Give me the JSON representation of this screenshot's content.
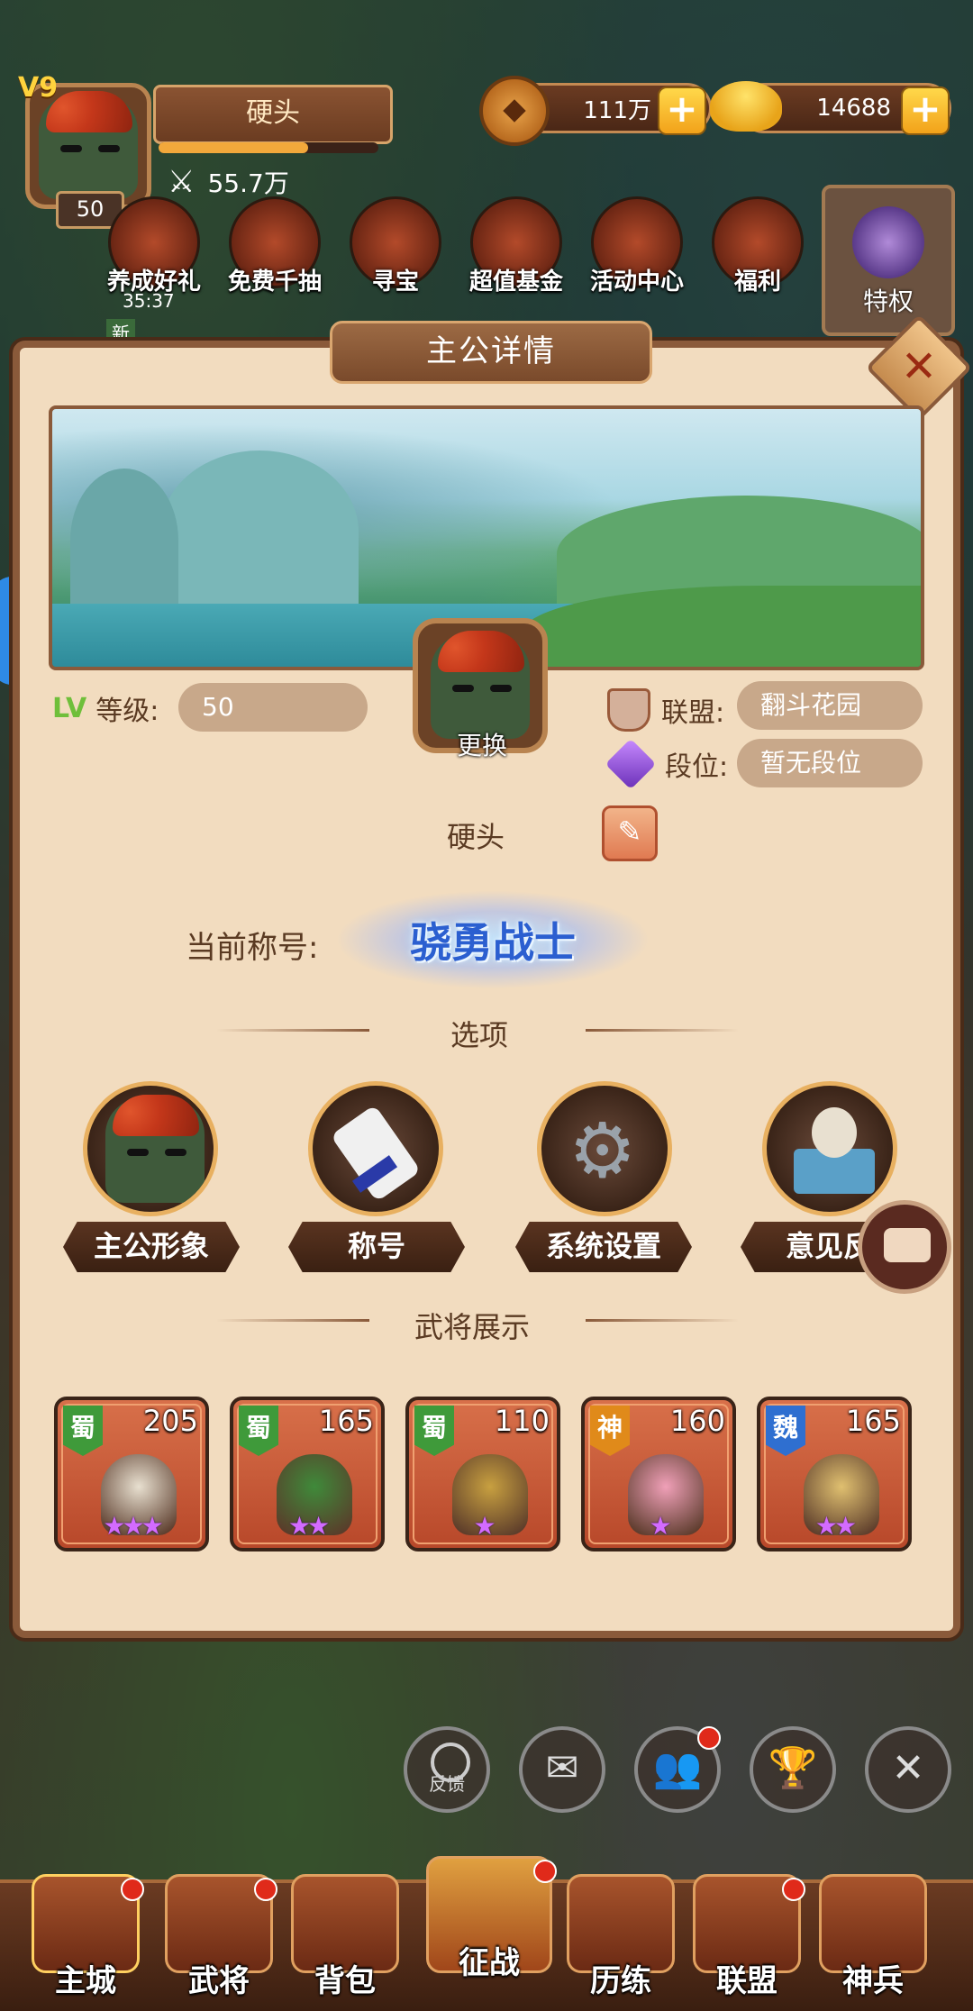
{
  "hud": {
    "vip": "V9",
    "name": "硬头",
    "level": "50",
    "power": "55.7万",
    "exp_fraction": 0.68,
    "copper": "111万",
    "gold": "14688",
    "timer": "35:37"
  },
  "top_buttons": [
    {
      "label": "养成好礼",
      "icon": "gift-icon"
    },
    {
      "label": "免费千抽",
      "icon": "cards-icon"
    },
    {
      "label": "寻宝",
      "icon": "treasure-icon"
    },
    {
      "label": "超值基金",
      "icon": "fund-icon"
    },
    {
      "label": "活动中心",
      "icon": "chest-icon"
    },
    {
      "label": "福利",
      "icon": "redpacket-icon"
    }
  ],
  "tequan": "特权",
  "new_tag": "新",
  "panel": {
    "title": "主公详情",
    "change_label": "更换",
    "level_label": "等级:",
    "lv_tag": "LV",
    "level_value": "50",
    "alliance_label": "联盟:",
    "alliance_value": "翻斗花园",
    "rank_label": "段位:",
    "rank_value": "暂无段位",
    "player_name": "硬头",
    "title_label": "当前称号:",
    "title_value": "骁勇战士",
    "options_title": "选项",
    "options": [
      {
        "label": "主公形象"
      },
      {
        "label": "称号"
      },
      {
        "label": "系统设置"
      },
      {
        "label": "意见反"
      }
    ],
    "heroes_title": "武将展示",
    "heroes": [
      {
        "faction": "蜀",
        "level": "205",
        "stars": 3,
        "faction_color": "#3f9a3a"
      },
      {
        "faction": "蜀",
        "level": "165",
        "stars": 2,
        "faction_color": "#3f9a3a"
      },
      {
        "faction": "蜀",
        "level": "110",
        "stars": 1,
        "faction_color": "#3f9a3a"
      },
      {
        "faction": "神",
        "level": "160",
        "stars": 1,
        "faction_color": "#e08a1a"
      },
      {
        "faction": "魏",
        "level": "165",
        "stars": 2,
        "faction_color": "#2f6fd0"
      }
    ]
  },
  "bottom_round": {
    "feedback_label": "反馈"
  },
  "nav": [
    {
      "label": "主城"
    },
    {
      "label": "武将"
    },
    {
      "label": "背包"
    },
    {
      "label": "征战"
    },
    {
      "label": "历练"
    },
    {
      "label": "联盟"
    },
    {
      "label": "神兵"
    }
  ]
}
